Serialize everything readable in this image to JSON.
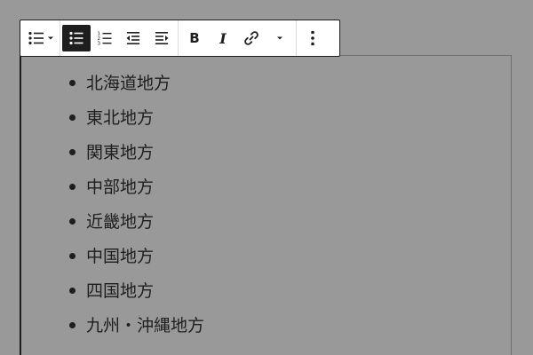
{
  "toolbar": {
    "groups": [
      {
        "buttons": [
          {
            "icon": "list-style-icon",
            "has_dropdown": true
          }
        ]
      },
      {
        "buttons": [
          {
            "icon": "unordered-list-icon",
            "active": true
          },
          {
            "icon": "ordered-list-icon"
          },
          {
            "icon": "outdent-icon"
          },
          {
            "icon": "indent-icon"
          }
        ]
      },
      {
        "buttons": [
          {
            "icon": "bold-icon",
            "label": "B"
          },
          {
            "icon": "italic-icon",
            "label": "I"
          },
          {
            "icon": "link-icon"
          },
          {
            "icon": "more-rich-text-icon",
            "has_dropdown": true
          }
        ]
      },
      {
        "buttons": [
          {
            "icon": "more-options-icon"
          }
        ]
      }
    ],
    "bold_label": "B",
    "italic_label": "I"
  },
  "colors": {
    "background": "#999999",
    "toolbar_bg": "#ffffff",
    "active_button": "#1e1e1e",
    "text": "#1e1e1e"
  },
  "list": {
    "items": [
      {
        "label": "北海道地方"
      },
      {
        "label": "東北地方"
      },
      {
        "label": "関東地方"
      },
      {
        "label": "中部地方"
      },
      {
        "label": "近畿地方"
      },
      {
        "label": "中国地方"
      },
      {
        "label": "四国地方"
      },
      {
        "label": "九州・沖縄地方"
      }
    ]
  }
}
